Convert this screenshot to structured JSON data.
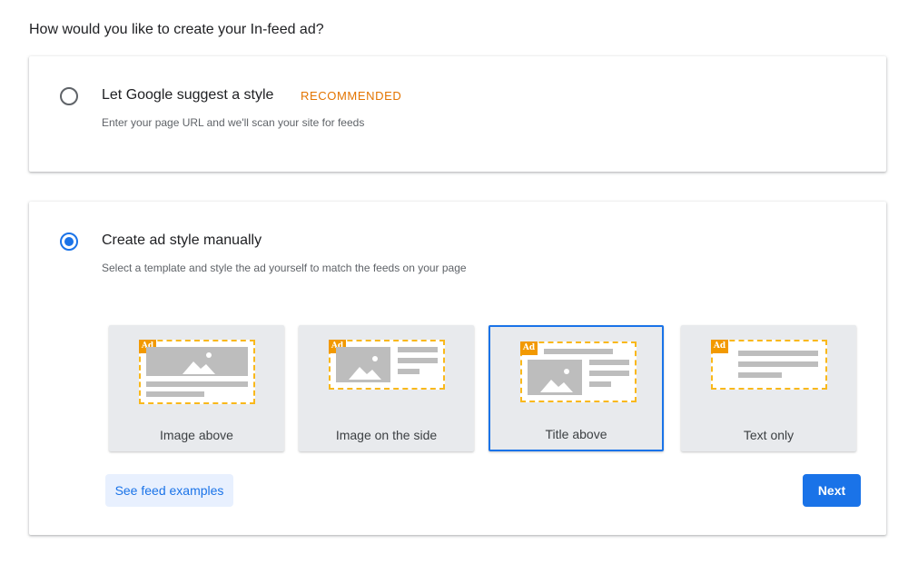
{
  "question": "How would you like to create your In-feed ad?",
  "options": [
    {
      "title": "Let Google suggest a style",
      "badge": "RECOMMENDED",
      "description": "Enter your page URL and we'll scan your site for feeds",
      "selected": false
    },
    {
      "title": "Create ad style manually",
      "description": "Select a template and style the ad yourself to match the feeds on your page",
      "selected": true
    }
  ],
  "templates": [
    {
      "label": "Image above",
      "badge": "Ad",
      "selected": false
    },
    {
      "label": "Image on the side",
      "badge": "Ad",
      "selected": false
    },
    {
      "label": "Title above",
      "badge": "Ad",
      "selected": true
    },
    {
      "label": "Text only",
      "badge": "Ad",
      "selected": false
    }
  ],
  "buttons": {
    "examples": "See feed examples",
    "next": "Next"
  },
  "colors": {
    "accent": "#1a73e8",
    "recommended": "#e37400",
    "ad_badge": "#f29900",
    "preview_border": "#f9b81b"
  },
  "icons": [
    "radio-unchecked",
    "radio-checked",
    "image-placeholder-icon"
  ]
}
